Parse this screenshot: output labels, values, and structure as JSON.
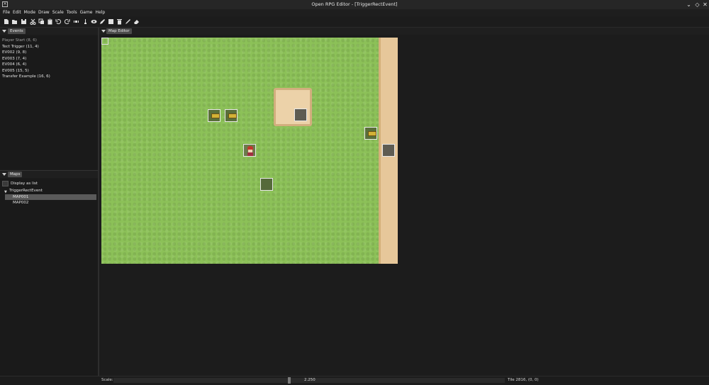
{
  "window": {
    "title": "Open RPG Editor - [TriggerRectEvent]",
    "controls": [
      "⌄",
      "◇",
      "✕"
    ]
  },
  "menu": [
    "File",
    "Edit",
    "Mode",
    "Draw",
    "Scale",
    "Tools",
    "Game",
    "Help"
  ],
  "toolbar": {
    "icons": [
      "new-file-icon",
      "open-folder-icon",
      "save-icon",
      "cut-icon",
      "copy-icon",
      "paste-icon",
      "undo-icon",
      "redo-icon",
      "layer-icon",
      "pin-icon",
      "eye-icon",
      "pencil-icon",
      "rectangle-icon",
      "trash-icon",
      "pen-icon",
      "eraser-icon"
    ]
  },
  "events_panel": {
    "tab": "Events",
    "items": [
      "Player Start (8, 6)",
      "Tect Trigger (11, 4)",
      "EV002 (9, 8)",
      "EV003 (7, 4)",
      "EV004 (6, 4)",
      "EV005 (15, 5)",
      "Transfer Example (16, 6)"
    ]
  },
  "maps_panel": {
    "tab": "Maps",
    "display_as_list": "Display as list",
    "tree_root": "TriggerRectEvent",
    "maps": [
      "MAP001",
      "MAP002"
    ],
    "selected": "MAP001"
  },
  "map_editor": {
    "tab": "Map Editor",
    "colors": {
      "grass": "#8cc158",
      "sand": "#e6c79a"
    }
  },
  "status": {
    "scale_label": "Scale:",
    "scale_value": "2.250",
    "scale_fraction": 0.45,
    "tile_info": "Tile 2816, (0, 0)"
  }
}
